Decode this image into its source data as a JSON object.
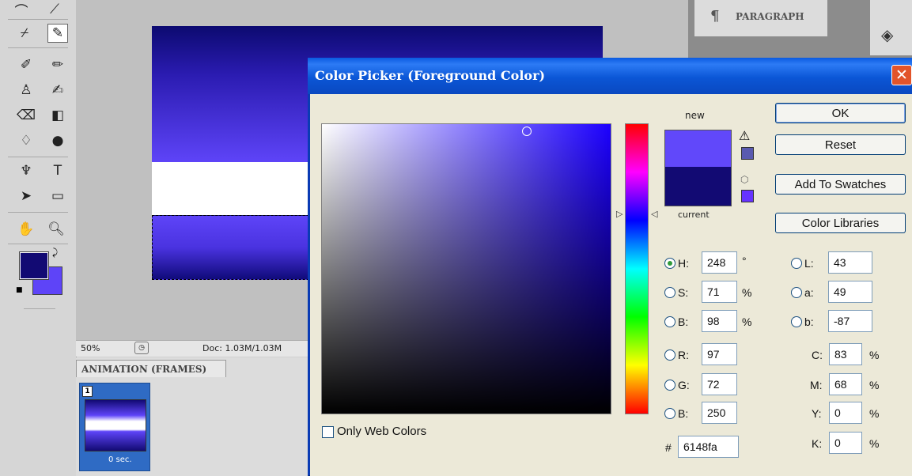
{
  "dialog": {
    "title": "Color Picker (Foreground Color)",
    "close_glyph": "✕",
    "buttons": {
      "ok": "OK",
      "reset": "Reset",
      "add_swatches": "Add To Swatches",
      "libraries": "Color Libraries"
    },
    "new_label": "new",
    "current_label": "current",
    "new_color": "#6148fa",
    "current_color": "#120a73",
    "only_web_colors": "Only Web Colors",
    "fields": {
      "H": {
        "label": "H:",
        "value": "248",
        "unit": "°"
      },
      "S": {
        "label": "S:",
        "value": "71",
        "unit": "%"
      },
      "B": {
        "label": "B:",
        "value": "98",
        "unit": "%"
      },
      "R": {
        "label": "R:",
        "value": "97"
      },
      "G": {
        "label": "G:",
        "value": "72"
      },
      "Bl": {
        "label": "B:",
        "value": "250"
      },
      "L": {
        "label": "L:",
        "value": "43"
      },
      "a": {
        "label": "a:",
        "value": "49"
      },
      "b": {
        "label": "b:",
        "value": "-87"
      },
      "C": {
        "label": "C:",
        "value": "83",
        "unit": "%"
      },
      "M": {
        "label": "M:",
        "value": "68",
        "unit": "%"
      },
      "Y": {
        "label": "Y:",
        "value": "0",
        "unit": "%"
      },
      "K": {
        "label": "K:",
        "value": "0",
        "unit": "%"
      },
      "hex": {
        "label": "#",
        "value": "6148fa"
      }
    }
  },
  "status": {
    "zoom": "50%",
    "doc": "Doc: 1.03M/1.03M"
  },
  "animation": {
    "tab": "ANIMATION (FRAMES)",
    "frame_number": "1",
    "frame_delay": "0 sec."
  },
  "panels": {
    "paragraph": "PARAGRAPH",
    "paragraph_glyph": "¶"
  },
  "toolbox": {
    "foreground_color": "#120a73",
    "background_color": "#5e44f8"
  }
}
